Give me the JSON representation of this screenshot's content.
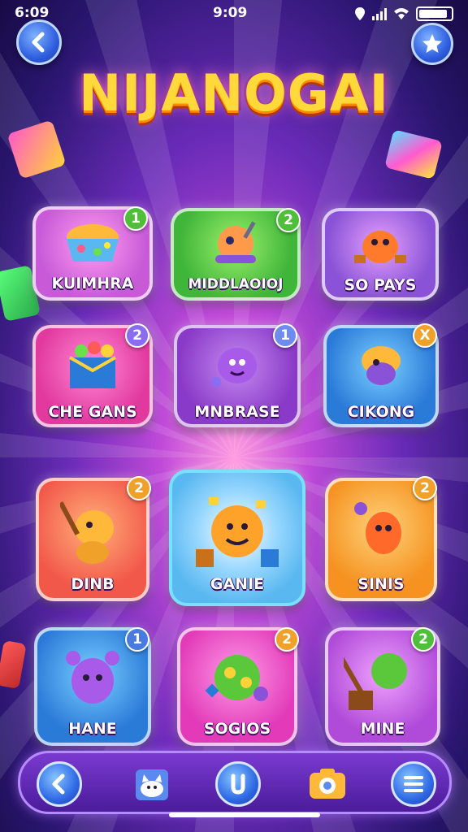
{
  "status_bar": {
    "time_left": "6:09",
    "time_center": "9:09"
  },
  "header": {
    "title": "NIJANOGAI"
  },
  "games": [
    {
      "label": "KUIMHRA",
      "badge": "1",
      "bg": "#c85ad8",
      "badge_color": "#4fbf3a"
    },
    {
      "label": "MIDDLAOIOJ",
      "badge": "2",
      "bg": "#3fb53a",
      "badge_color": "#4fbf3a"
    },
    {
      "label": "SO PAYS",
      "badge": "",
      "bg": "#8a52d6",
      "badge_color": "#8a52d6"
    },
    {
      "label": "CHE GANS",
      "badge": "2",
      "bg": "#e2399e",
      "badge_color": "#8a6cf0"
    },
    {
      "label": "MNBRASE",
      "badge": "1",
      "bg": "#8a3ac8",
      "badge_color": "#6e8cf0"
    },
    {
      "label": "CIKONG",
      "badge": "X",
      "bg": "#2a7ad8",
      "badge_color": "#f0a12a"
    },
    {
      "label": "DINB",
      "badge": "2",
      "bg": "#f2584a",
      "badge_color": "#f0a12a"
    },
    {
      "label": "GANIE",
      "badge": "",
      "bg": "#5ab8f0",
      "badge_color": "#5ab8f0"
    },
    {
      "label": "SINIS",
      "badge": "2",
      "bg": "#f59220",
      "badge_color": "#f0a12a"
    },
    {
      "label": "HANE",
      "badge": "1",
      "bg": "#2a7ad8",
      "badge_color": "#4a7ae0"
    },
    {
      "label": "SOGIOS",
      "badge": "2",
      "bg": "#e23ab8",
      "badge_color": "#f0a12a"
    },
    {
      "label": "MINE",
      "badge": "2",
      "bg": "#b04ad8",
      "badge_color": "#4fbf3a"
    }
  ],
  "icons": {
    "back": "back-arrow-icon",
    "star": "star-icon",
    "nav": [
      "back-arrow-icon",
      "cat-icon",
      "download-icon",
      "camera-icon",
      "menu-icon"
    ]
  },
  "colors": {
    "title_fill": "#ffd83a",
    "title_outline": "#b2380e",
    "nav_bg": "#5a24b0",
    "button_blue": "#2f5ee0"
  }
}
